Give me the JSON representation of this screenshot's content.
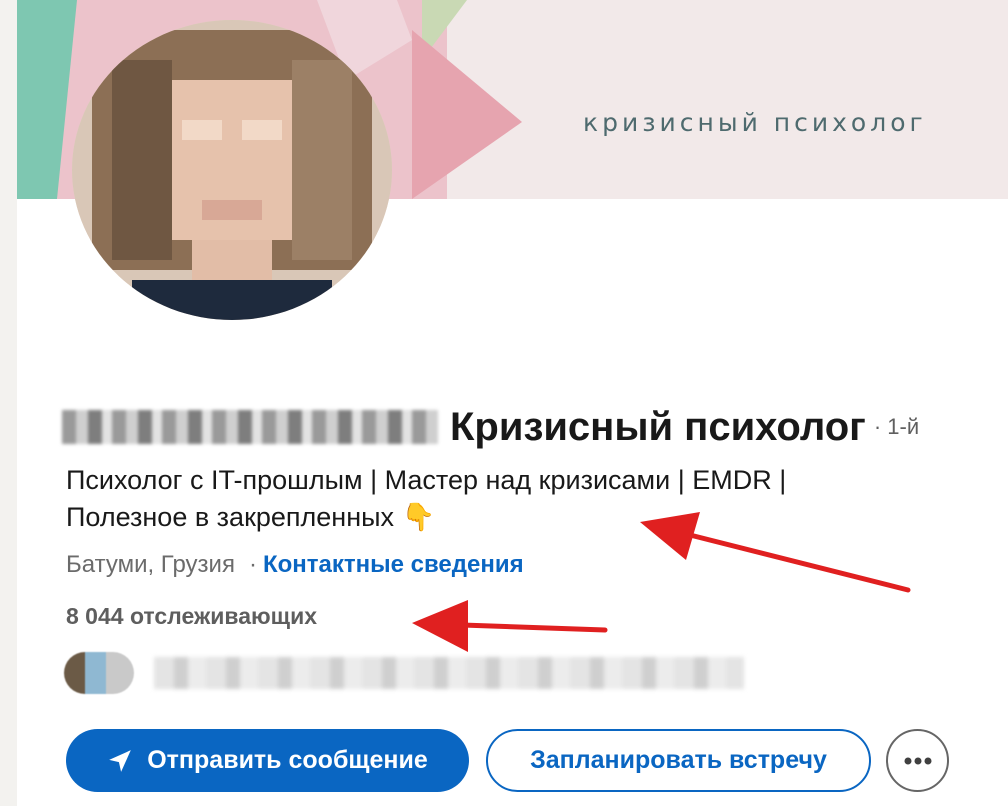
{
  "banner": {
    "text": "кризисный психолог"
  },
  "profile": {
    "name": "Кризисный психолог",
    "degree": "· 1-й",
    "headline_line1": "Психолог с IT-прошлым | Мастер над кризисами | EMDR |",
    "headline_line2": "Полезное в закрепленных",
    "headline_emoji": "👇",
    "location": "Батуми, Грузия",
    "separator": "·",
    "contact_link": "Контактные сведения",
    "followers": "8 044 отслеживающих"
  },
  "actions": {
    "message_label": "Отправить сообщение",
    "schedule_label": "Запланировать встречу",
    "more_icon": "more-horizontal-icon"
  },
  "colors": {
    "accent": "#0a66c2",
    "annotation_arrow": "#e02020",
    "banner_bg": "#f2e9e9",
    "banner_pink": "#e8a9b3",
    "banner_teal": "#7ec7b1"
  }
}
